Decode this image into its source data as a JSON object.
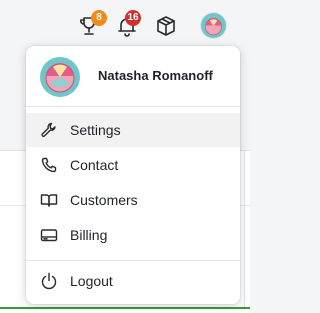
{
  "topbar": {
    "trophy": {
      "icon": "trophy-icon",
      "badge": "8",
      "badge_color": "#f28b1e"
    },
    "notifications": {
      "icon": "bell-icon",
      "badge": "16",
      "badge_color": "#d32f2f"
    },
    "package": {
      "icon": "box-icon"
    },
    "profile": {
      "icon": "avatar"
    }
  },
  "menu": {
    "user_name": "Natasha Romanoff",
    "items": [
      {
        "label": "Settings",
        "icon": "wrench-icon",
        "active": true
      },
      {
        "label": "Contact",
        "icon": "phone-icon"
      },
      {
        "label": "Customers",
        "icon": "book-icon"
      },
      {
        "label": "Billing",
        "icon": "credit-card-icon"
      }
    ],
    "logout_label": "Logout"
  }
}
